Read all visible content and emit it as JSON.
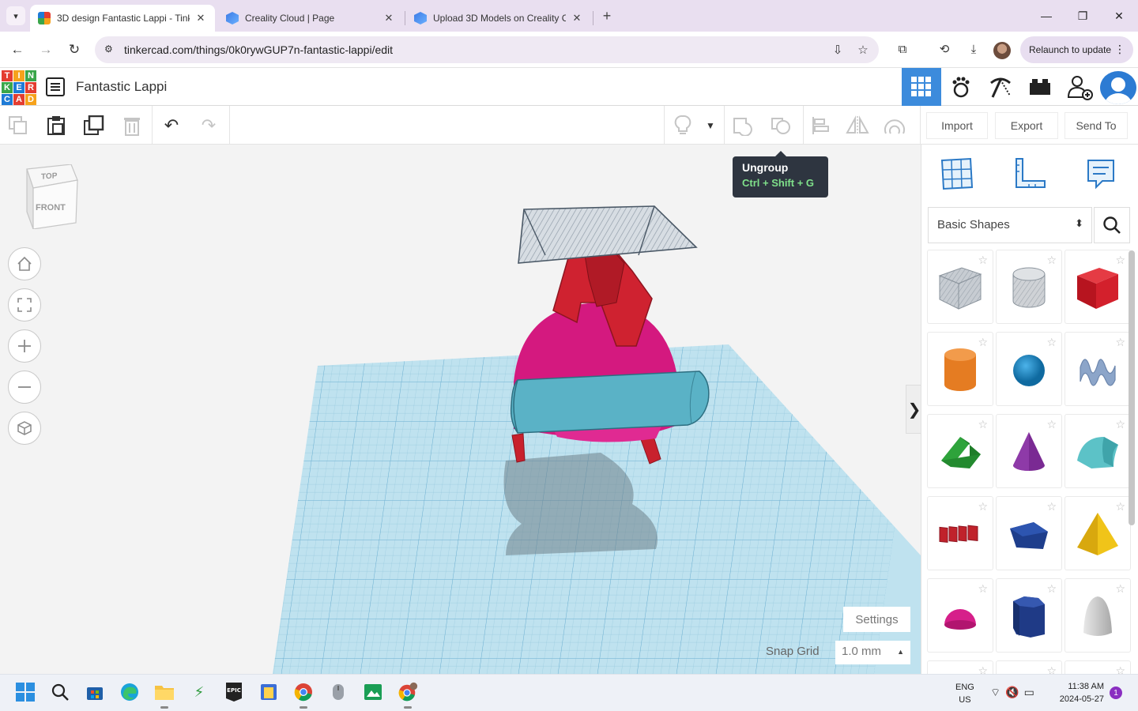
{
  "browser": {
    "tabs": [
      {
        "title": "3D design Fantastic Lappi - Tink",
        "active": true
      },
      {
        "title": "Creality Cloud | Page",
        "active": false
      },
      {
        "title": "Upload 3D Models on Creality C",
        "active": false
      }
    ],
    "url": "tinkercad.com/things/0k0rywGUP7n-fantastic-lappi/edit",
    "relaunch_label": "Relaunch to update"
  },
  "app": {
    "logo_letters": [
      "T",
      "I",
      "N",
      "K",
      "E",
      "R",
      "C",
      "A",
      "D"
    ],
    "design_title": "Fantastic Lappi"
  },
  "toolbar": {
    "import_label": "Import",
    "export_label": "Export",
    "send_to_label": "Send To"
  },
  "tooltip": {
    "title": "Ungroup",
    "shortcut": "Ctrl + Shift + G"
  },
  "viewcube": {
    "top_label": "TOP",
    "front_label": "FRONT"
  },
  "workplane": {
    "settings_label": "Settings",
    "snap_grid_label": "Snap Grid",
    "snap_grid_value": "1.0 mm"
  },
  "shapes_panel": {
    "category": "Basic Shapes",
    "shapes": [
      {
        "name": "box-hole",
        "color": "#b9bec4"
      },
      {
        "name": "cylinder-hole",
        "color": "#c4c7cb"
      },
      {
        "name": "box",
        "color": "#d3202c"
      },
      {
        "name": "cylinder",
        "color": "#e57c22"
      },
      {
        "name": "sphere",
        "color": "#1e8ac3"
      },
      {
        "name": "scribble",
        "color": "#8ca5c9"
      },
      {
        "name": "roof",
        "color": "#2ea33b"
      },
      {
        "name": "cone",
        "color": "#7a2a93"
      },
      {
        "name": "round-roof",
        "color": "#5cc2c7"
      },
      {
        "name": "text",
        "color": "#c0222b"
      },
      {
        "name": "polygon",
        "color": "#1e3e8c"
      },
      {
        "name": "pyramid",
        "color": "#f0c419"
      },
      {
        "name": "half-sphere",
        "color": "#d61f8a"
      },
      {
        "name": "hexagonal-prism",
        "color": "#1f3a86"
      },
      {
        "name": "paraboloid",
        "color": "#c8c8c8"
      }
    ]
  },
  "taskbar": {
    "lang_top": "ENG",
    "lang_bottom": "US",
    "time": "11:38 AM",
    "date": "2024-05-27",
    "notification_count": "1"
  }
}
